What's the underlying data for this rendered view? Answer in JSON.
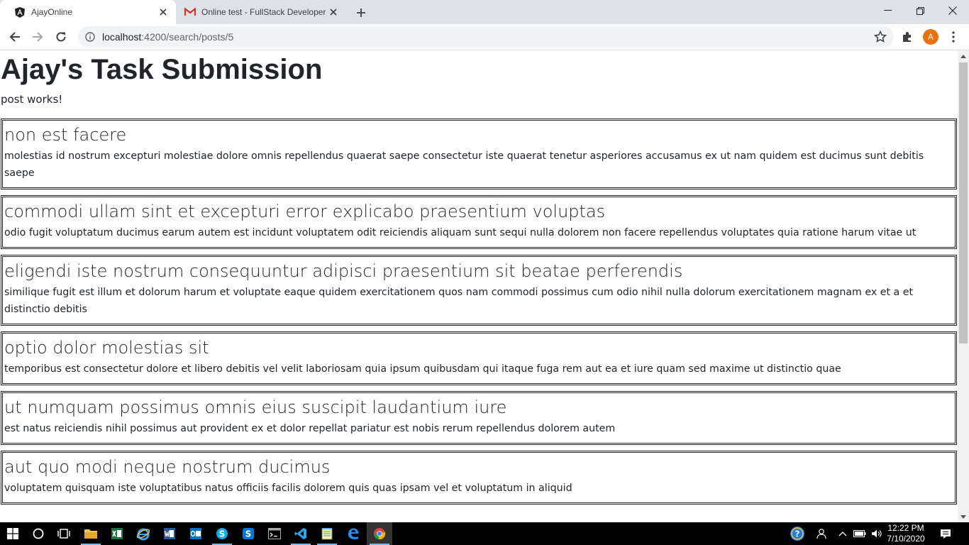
{
  "browser": {
    "tabs": [
      {
        "title": "AjayOnline",
        "icon": "angular-icon",
        "active": true
      },
      {
        "title": "Online test - FullStack Developer",
        "icon": "gmail-icon",
        "active": false
      }
    ],
    "url_host": "localhost",
    "url_path": ":4200/search/posts/5",
    "profile_initial": "A",
    "profile_color": "#e8710a"
  },
  "page": {
    "title": "Ajay's Task Submission",
    "status": "post works!",
    "posts": [
      {
        "title": "non est facere",
        "body": "molestias id nostrum excepturi molestiae dolore omnis repellendus quaerat saepe consectetur iste quaerat tenetur asperiores accusamus ex ut nam quidem est ducimus sunt debitis saepe"
      },
      {
        "title": "commodi ullam sint et excepturi error explicabo praesentium voluptas",
        "body": "odio fugit voluptatum ducimus earum autem est incidunt voluptatem odit reiciendis aliquam sunt sequi nulla dolorem non facere repellendus voluptates quia ratione harum vitae ut"
      },
      {
        "title": "eligendi iste nostrum consequuntur adipisci praesentium sit beatae perferendis",
        "body": "similique fugit est illum et dolorum harum et voluptate eaque quidem exercitationem quos nam commodi possimus cum odio nihil nulla dolorum exercitationem magnam ex et a et distinctio debitis"
      },
      {
        "title": "optio dolor molestias sit",
        "body": "temporibus est consectetur dolore et libero debitis vel velit laboriosam quia ipsum quibusdam qui itaque fuga rem aut ea et iure quam sed maxime ut distinctio quae"
      },
      {
        "title": "ut numquam possimus omnis eius suscipit laudantium iure",
        "body": "est natus reiciendis nihil possimus aut provident ex et dolor repellat pariatur est nobis rerum repellendus dolorem autem"
      },
      {
        "title": "aut quo modi neque nostrum ducimus",
        "body": "voluptatem quisquam iste voluptatibus natus officiis facilis dolorem quis quas ipsam vel et voluptatum in aliquid"
      }
    ]
  },
  "taskbar": {
    "apps": [
      "windows-start-icon",
      "cortana-icon",
      "task-view-icon",
      "file-explorer-icon",
      "excel-icon",
      "ie-icon",
      "word-icon",
      "outlook-icon",
      "skype-icon",
      "skype-business-icon",
      "cmd-icon",
      "vscode-icon",
      "notepad-icon",
      "edge-icon",
      "chrome-icon"
    ],
    "time": "12:22 PM",
    "date": "7/10/2020"
  }
}
